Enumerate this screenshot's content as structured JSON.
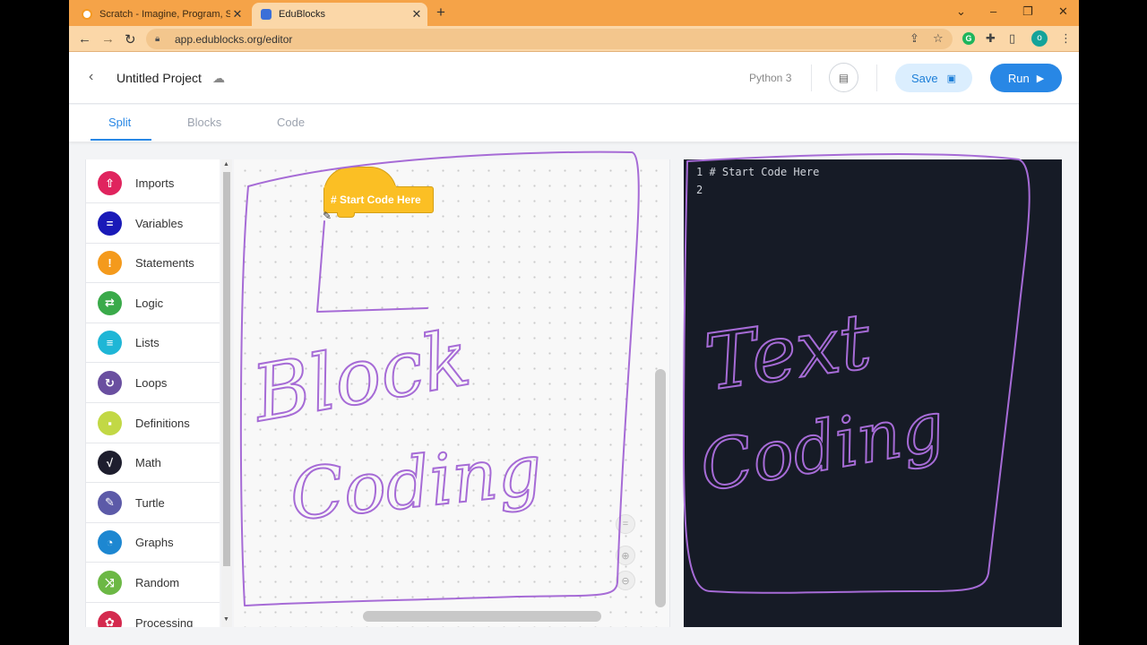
{
  "browser": {
    "tabs": [
      {
        "title": "Scratch - Imagine, Program, Sha",
        "active": false
      },
      {
        "title": "EduBlocks",
        "active": true
      }
    ],
    "url": "app.edublocks.org/editor",
    "profile_initial": "o",
    "grammarly_initial": "G"
  },
  "header": {
    "project_title": "Untitled Project",
    "language": "Python 3",
    "save_label": "Save",
    "run_label": "Run"
  },
  "mode_tabs": [
    {
      "label": "Split",
      "active": true
    },
    {
      "label": "Blocks",
      "active": false
    },
    {
      "label": "Code",
      "active": false
    }
  ],
  "toolbox": {
    "categories": [
      {
        "label": "Imports",
        "color": "#e0245e",
        "icon": "upload-icon"
      },
      {
        "label": "Variables",
        "color": "#1a1ab8",
        "icon": "equals-icon"
      },
      {
        "label": "Statements",
        "color": "#f49a1c",
        "icon": "exclamation-icon"
      },
      {
        "label": "Logic",
        "color": "#3aaa4a",
        "icon": "swap-arrows-icon"
      },
      {
        "label": "Lists",
        "color": "#1fb6d6",
        "icon": "list-icon"
      },
      {
        "label": "Loops",
        "color": "#6a4fa0",
        "icon": "loop-arrow-icon"
      },
      {
        "label": "Definitions",
        "color": "#c2d845",
        "icon": "square-icon"
      },
      {
        "label": "Math",
        "color": "#1e1e2e",
        "icon": "sqrt-icon"
      },
      {
        "label": "Turtle",
        "color": "#5c5aa8",
        "icon": "pencil-icon"
      },
      {
        "label": "Graphs",
        "color": "#1d87d1",
        "icon": "pie-chart-icon"
      },
      {
        "label": "Random",
        "color": "#6cb845",
        "icon": "shuffle-icon"
      },
      {
        "label": "Processing",
        "color": "#d42a4e",
        "icon": "palette-icon"
      }
    ]
  },
  "workspace": {
    "start_block_label": "# Start Code Here"
  },
  "editor": {
    "lines": [
      {
        "number": "1",
        "text": "# Start Code Here"
      },
      {
        "number": "2",
        "text": ""
      }
    ]
  },
  "annotations": {
    "left_text_line1": "Block",
    "left_text_line2": "Coding",
    "right_text_line1": "Text",
    "right_text_line2": "Coding",
    "pen_color": "#a66bd6"
  }
}
